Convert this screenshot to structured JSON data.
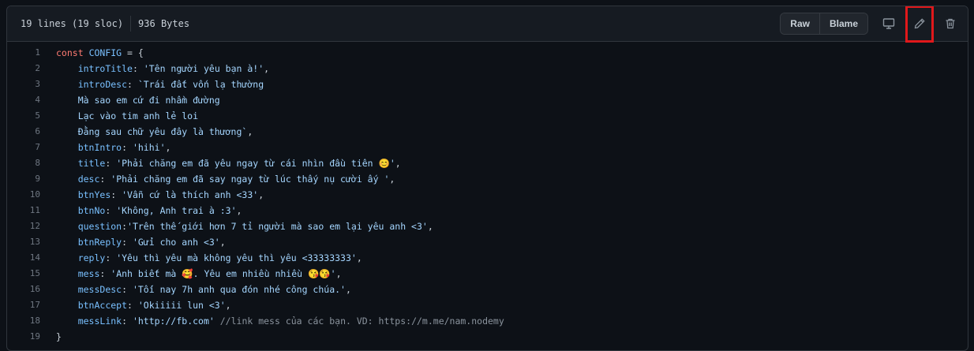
{
  "file": {
    "lines_info": "19 lines (19 sloc)",
    "size": "936 Bytes"
  },
  "toolbar": {
    "raw_label": "Raw",
    "blame_label": "Blame",
    "icons": [
      "display-icon",
      "pencil-icon",
      "trash-icon"
    ],
    "highlight_color": "#e0181b"
  },
  "code": {
    "lines": [
      {
        "n": "1",
        "parts": [
          [
            "kw",
            "const"
          ],
          [
            "t",
            " "
          ],
          [
            "const",
            "CONFIG"
          ],
          [
            "t",
            " = {"
          ]
        ]
      },
      {
        "n": "2",
        "parts": [
          [
            "t",
            "    "
          ],
          [
            "prop",
            "introTitle"
          ],
          [
            "t",
            ": "
          ],
          [
            "str",
            "'Tên người yêu bạn à!'"
          ],
          [
            "t",
            ","
          ]
        ]
      },
      {
        "n": "3",
        "parts": [
          [
            "t",
            "    "
          ],
          [
            "prop",
            "introDesc"
          ],
          [
            "t",
            ": "
          ],
          [
            "str",
            "`Trái đất vốn lạ thường"
          ]
        ]
      },
      {
        "n": "4",
        "parts": [
          [
            "str",
            "    Mà sao em cứ đi nhầm đường"
          ]
        ]
      },
      {
        "n": "5",
        "parts": [
          [
            "str",
            "    Lạc vào tim anh lẻ loi"
          ]
        ]
      },
      {
        "n": "6",
        "parts": [
          [
            "str",
            "    Đằng sau chữ yêu đây là thương`"
          ],
          [
            "t",
            ","
          ]
        ]
      },
      {
        "n": "7",
        "parts": [
          [
            "t",
            "    "
          ],
          [
            "prop",
            "btnIntro"
          ],
          [
            "t",
            ": "
          ],
          [
            "str",
            "'hihi'"
          ],
          [
            "t",
            ","
          ]
        ]
      },
      {
        "n": "8",
        "parts": [
          [
            "t",
            "    "
          ],
          [
            "prop",
            "title"
          ],
          [
            "t",
            ": "
          ],
          [
            "str",
            "'Phải chăng em đã yêu ngay từ cái nhìn đầu tiên 😊'"
          ],
          [
            "t",
            ","
          ]
        ]
      },
      {
        "n": "9",
        "parts": [
          [
            "t",
            "    "
          ],
          [
            "prop",
            "desc"
          ],
          [
            "t",
            ": "
          ],
          [
            "str",
            "'Phải chăng em đã say ngay từ lúc thấy nụ cười ấy '"
          ],
          [
            "t",
            ","
          ]
        ]
      },
      {
        "n": "10",
        "parts": [
          [
            "t",
            "    "
          ],
          [
            "prop",
            "btnYes"
          ],
          [
            "t",
            ": "
          ],
          [
            "str",
            "'Vẫn cứ là thích anh <33'"
          ],
          [
            "t",
            ","
          ]
        ]
      },
      {
        "n": "11",
        "parts": [
          [
            "t",
            "    "
          ],
          [
            "prop",
            "btnNo"
          ],
          [
            "t",
            ": "
          ],
          [
            "str",
            "'Không, Anh trai à :3'"
          ],
          [
            "t",
            ","
          ]
        ]
      },
      {
        "n": "12",
        "parts": [
          [
            "t",
            "    "
          ],
          [
            "prop",
            "question"
          ],
          [
            "t",
            ":"
          ],
          [
            "str",
            "'Trên thế giới hơn 7 tỉ người mà sao em lại yêu anh <3'"
          ],
          [
            "t",
            ","
          ]
        ]
      },
      {
        "n": "13",
        "parts": [
          [
            "t",
            "    "
          ],
          [
            "prop",
            "btnReply"
          ],
          [
            "t",
            ": "
          ],
          [
            "str",
            "'Gửi cho anh <3'"
          ],
          [
            "t",
            ","
          ]
        ]
      },
      {
        "n": "14",
        "parts": [
          [
            "t",
            "    "
          ],
          [
            "prop",
            "reply"
          ],
          [
            "t",
            ": "
          ],
          [
            "str",
            "'Yêu thì yêu mà không yêu thì yêu <33333333'"
          ],
          [
            "t",
            ","
          ]
        ]
      },
      {
        "n": "15",
        "parts": [
          [
            "t",
            "    "
          ],
          [
            "prop",
            "mess"
          ],
          [
            "t",
            ": "
          ],
          [
            "str",
            "'Anh biết mà 🥰. Yêu em nhiều nhiều 😘😘'"
          ],
          [
            "t",
            ","
          ]
        ]
      },
      {
        "n": "16",
        "parts": [
          [
            "t",
            "    "
          ],
          [
            "prop",
            "messDesc"
          ],
          [
            "t",
            ": "
          ],
          [
            "str",
            "'Tối nay 7h anh qua đón nhé công chúa.'"
          ],
          [
            "t",
            ","
          ]
        ]
      },
      {
        "n": "17",
        "parts": [
          [
            "t",
            "    "
          ],
          [
            "prop",
            "btnAccept"
          ],
          [
            "t",
            ": "
          ],
          [
            "str",
            "'Okiiiii lun <3'"
          ],
          [
            "t",
            ","
          ]
        ]
      },
      {
        "n": "18",
        "parts": [
          [
            "t",
            "    "
          ],
          [
            "prop",
            "messLink"
          ],
          [
            "t",
            ": "
          ],
          [
            "str",
            "'http://fb.com'"
          ],
          [
            "t",
            " "
          ],
          [
            "cmt",
            "//link mess của các bạn. VD: https://m.me/nam.nodemy"
          ]
        ]
      },
      {
        "n": "19",
        "parts": [
          [
            "t",
            "}"
          ]
        ]
      }
    ]
  },
  "colors": {
    "background": "#0d1117",
    "header_background": "#161b22",
    "keyword": "#ff7b72",
    "identifier": "#79c0ff",
    "string": "#a5d6ff",
    "comment": "#8b949e"
  }
}
